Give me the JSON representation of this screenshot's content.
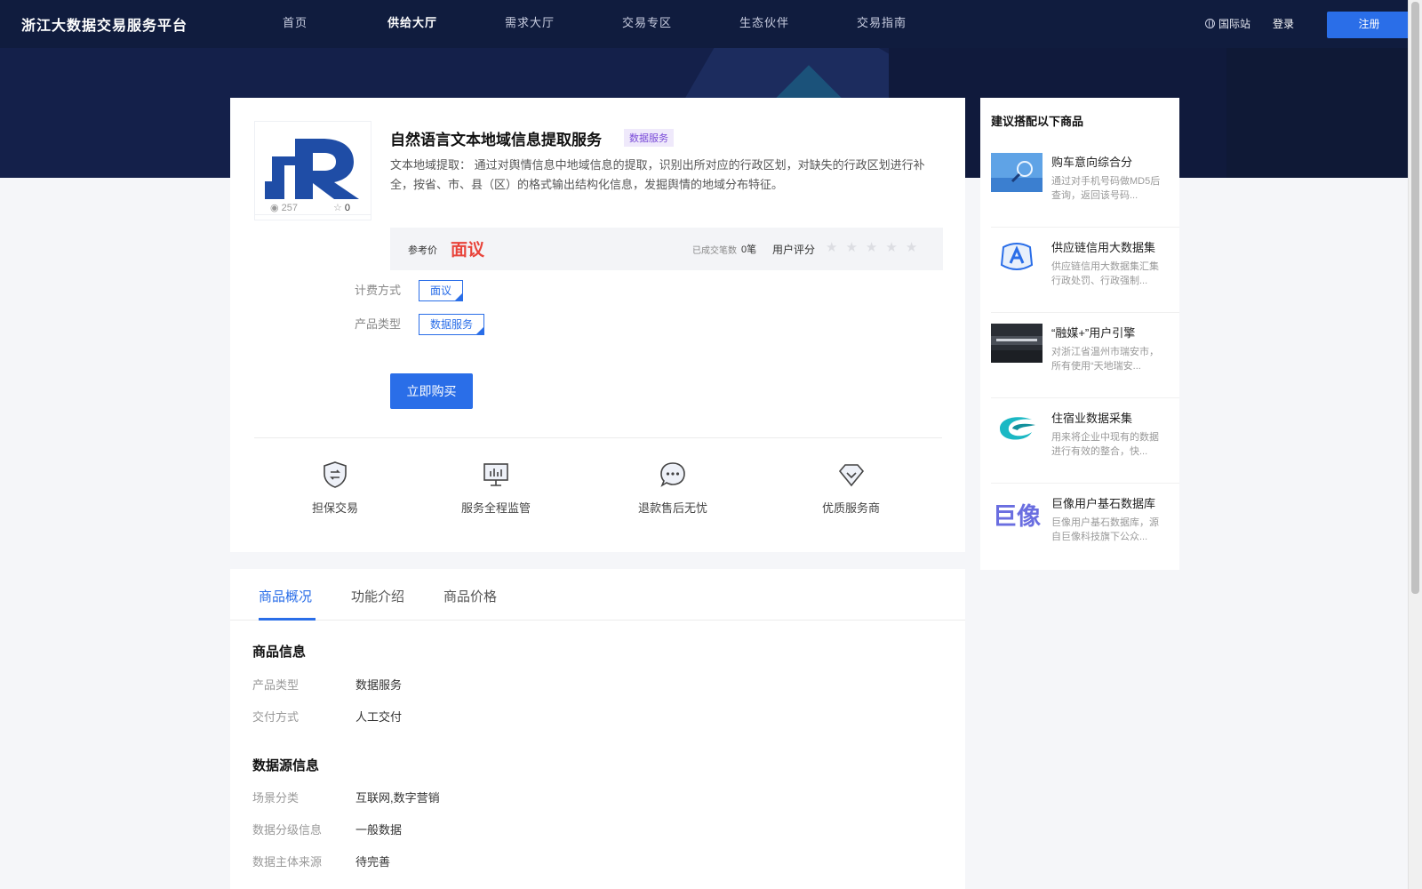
{
  "header": {
    "logo": "浙江大数据交易服务平台",
    "nav": [
      "首页",
      "供给大厅",
      "需求大厅",
      "交易专区",
      "生态伙伴",
      "交易指南"
    ],
    "active_nav_index": 1,
    "intl": "国际站",
    "login": "登录",
    "register": "注册"
  },
  "product": {
    "title": "自然语言文本地域信息提取服务",
    "tag": "数据服务",
    "description": "文本地域提取： 通过对舆情信息中地域信息的提取，识别出所对应的行政区划，对缺失的行政区划进行补全，按省、市、县（区）的格式输出结构化信息，发掘舆情的地域分布特征。",
    "views": "257",
    "favorites": "0",
    "price_label": "参考价",
    "price": "面议",
    "deals_label": "已成交笔数",
    "deals_value": "0笔",
    "rating_label": "用户评分",
    "rating_stars": 0,
    "billing_label": "计费方式",
    "billing_value": "面议",
    "type_label": "产品类型",
    "type_value": "数据服务",
    "buy_button": "立即购买"
  },
  "features": [
    "担保交易",
    "服务全程监管",
    "退款售后无忧",
    "优质服务商"
  ],
  "tabs": [
    "商品概况",
    "功能介绍",
    "商品价格"
  ],
  "info": {
    "section1_title": "商品信息",
    "section1": [
      {
        "label": "产品类型",
        "value": "数据服务"
      },
      {
        "label": "交付方式",
        "value": "人工交付"
      }
    ],
    "section2_title": "数据源信息",
    "section2": [
      {
        "label": "场景分类",
        "value": "互联网,数字营销"
      },
      {
        "label": "数据分级信息",
        "value": "一般数据"
      },
      {
        "label": "数据主体来源",
        "value": "待完善"
      }
    ]
  },
  "sidebar": {
    "title": "建议搭配以下商品",
    "items": [
      {
        "name": "购车意向综合分",
        "desc": "通过对手机号码做MD5后查询，返回该号码..."
      },
      {
        "name": "供应链信用大数据集",
        "desc": "供应链信用大数据集汇集行政处罚、行政强制..."
      },
      {
        "name": "“融媒+”用户引擎",
        "desc": "对浙江省温州市瑞安市，所有使用“天地瑞安..."
      },
      {
        "name": "住宿业数据采集",
        "desc": "用来将企业中现有的数据进行有效的整合，快..."
      },
      {
        "name": "巨像用户基石数据库",
        "desc": "巨像用户基石数据库，源自巨像科技旗下公众..."
      }
    ],
    "thumb_text_5": "巨像"
  },
  "colors": {
    "header_bg": "#101c3e",
    "accent": "#2a6ee8",
    "price": "#e8433a",
    "tag_bg": "#efe9fb",
    "tag_text": "#7a4bd8"
  }
}
